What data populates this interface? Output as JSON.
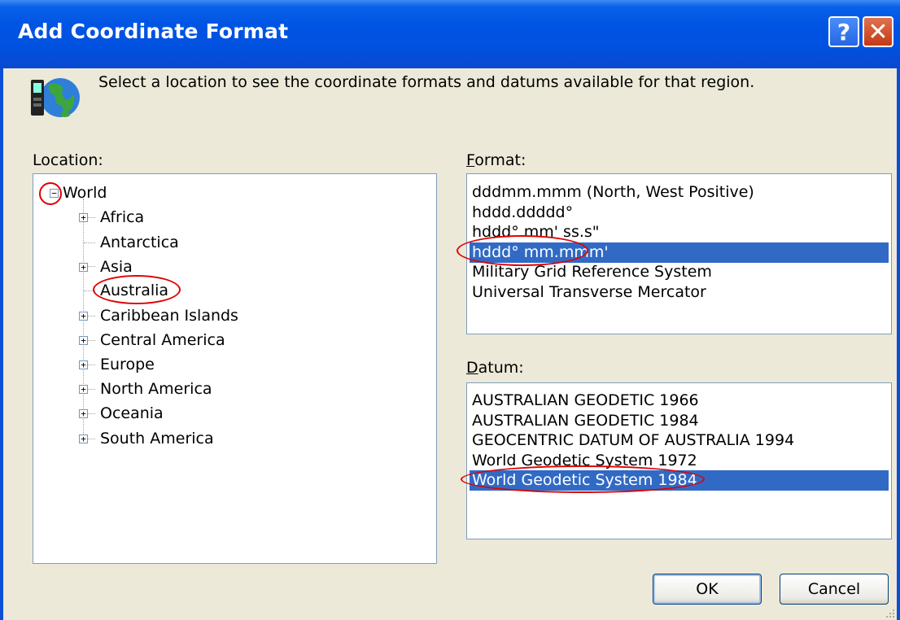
{
  "window": {
    "title": "Add Coordinate Format",
    "help_glyph": "?",
    "close_glyph": "✕"
  },
  "instruction": "Select a location to see the coordinate formats and datums available for that region.",
  "location": {
    "label": "Location:",
    "tree": {
      "root": {
        "label": "World",
        "expander": "−"
      },
      "children": [
        {
          "label": "Africa",
          "expander": "+"
        },
        {
          "label": "Antarctica",
          "expander": ""
        },
        {
          "label": "Asia",
          "expander": "+"
        },
        {
          "label": "Australia",
          "expander": "",
          "selected": true
        },
        {
          "label": "Caribbean Islands",
          "expander": "+"
        },
        {
          "label": "Central America",
          "expander": "+"
        },
        {
          "label": "Europe",
          "expander": "+"
        },
        {
          "label": "North America",
          "expander": "+"
        },
        {
          "label": "Oceania",
          "expander": "+"
        },
        {
          "label": "South America",
          "expander": "+"
        }
      ]
    }
  },
  "format": {
    "label_first": "F",
    "label_rest": "ormat:",
    "items": [
      "dddmm.mmm (North, West Positive)",
      "hddd.ddddd°",
      "hddd° mm' ss.s\"",
      "hddd° mm.mmm'",
      "Military Grid Reference System",
      "Universal Transverse Mercator"
    ],
    "selected_index": 3
  },
  "datum": {
    "label_first": "D",
    "label_rest": "atum:",
    "items": [
      "AUSTRALIAN GEODETIC 1966",
      "AUSTRALIAN GEODETIC 1984",
      "GEOCENTRIC DATUM OF AUSTRALIA 1994",
      "World Geodetic System 1972",
      "World Geodetic System 1984"
    ],
    "selected_index": 4
  },
  "buttons": {
    "ok": "OK",
    "cancel": "Cancel"
  },
  "colors": {
    "selection": "#316ac5",
    "annotation": "#e00000",
    "titlebar": "#0054e3"
  }
}
